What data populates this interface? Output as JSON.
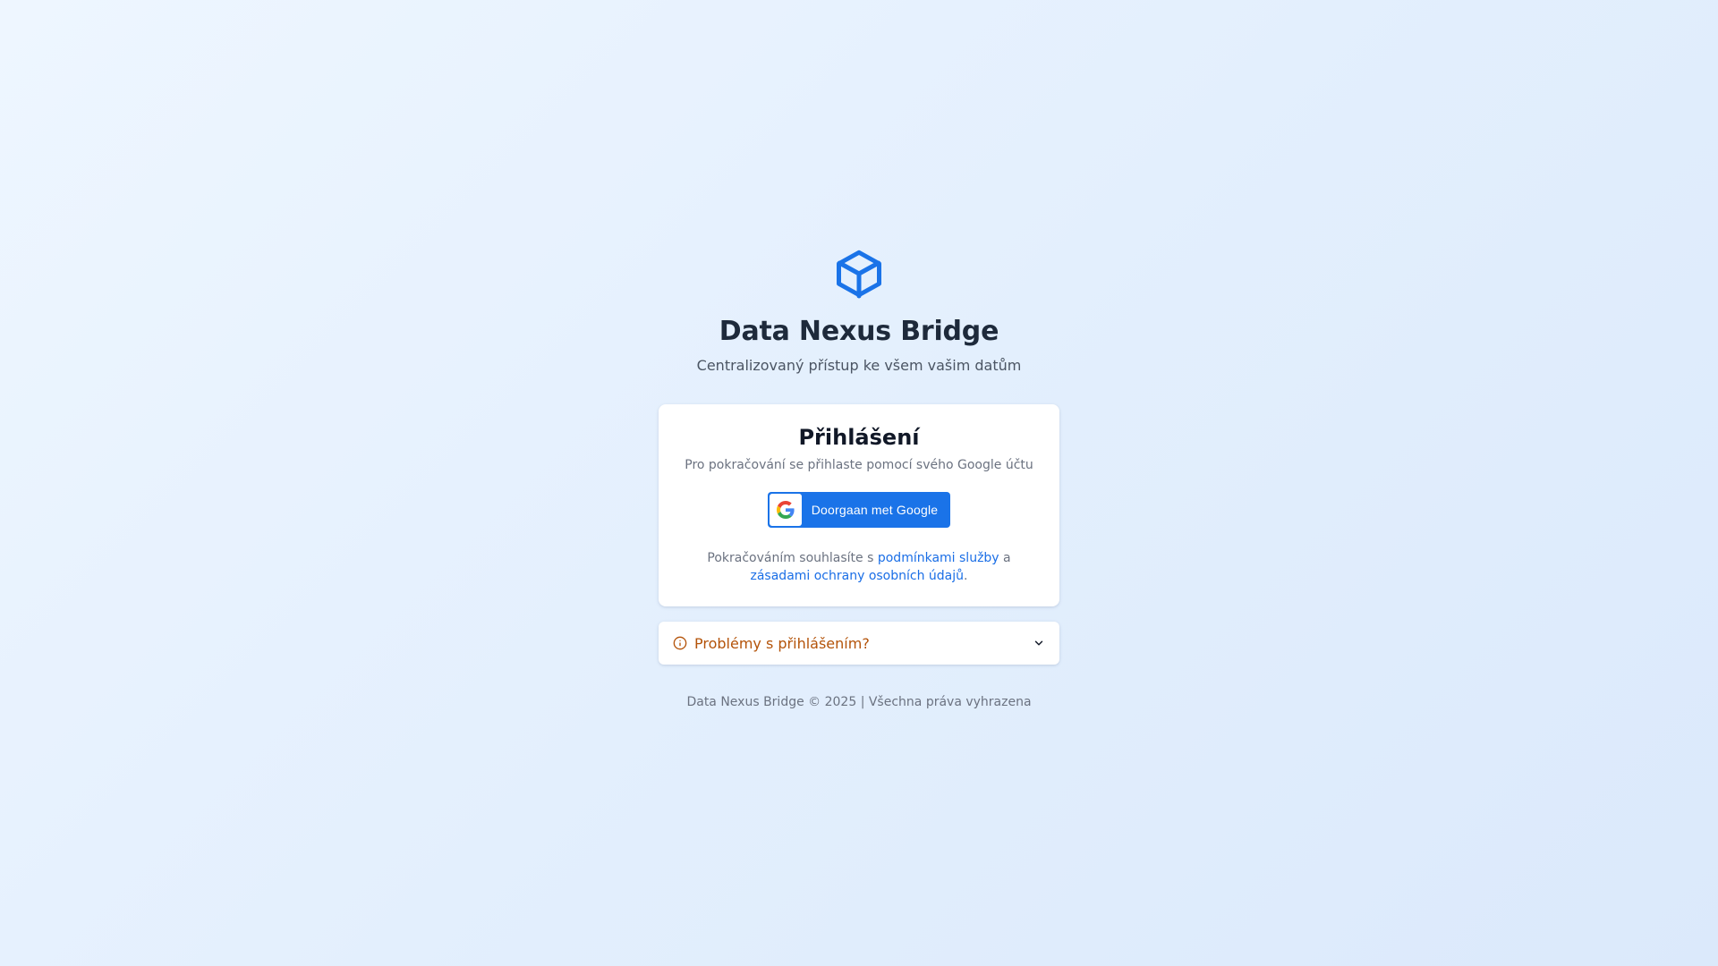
{
  "header": {
    "logo_icon": "cube-icon",
    "app_title": "Data Nexus Bridge",
    "app_subtitle": "Centralizovaný přístup ke všem vašim datům"
  },
  "login_card": {
    "title": "Přihlášení",
    "subtitle": "Pro pokračování se přihlaste pomocí svého Google účtu",
    "google_button": {
      "icon": "google-icon",
      "label": "Doorgaan met Google"
    },
    "terms": {
      "prefix": "Pokračováním souhlasíte s ",
      "terms_link": "podmínkami služby",
      "conjunction": " a ",
      "privacy_link": "zásadami ochrany osobních údajů",
      "suffix": "."
    }
  },
  "help_panel": {
    "icon": "info-icon",
    "label": "Problémy s přihlášením?",
    "toggle_icon": "chevron-down-icon"
  },
  "footer": {
    "text": "Data Nexus Bridge © 2025 | Všechna práva vyhrazena"
  },
  "colors": {
    "accent": "#1a73e8",
    "warning": "#b45309",
    "title": "#1e2a3b"
  }
}
